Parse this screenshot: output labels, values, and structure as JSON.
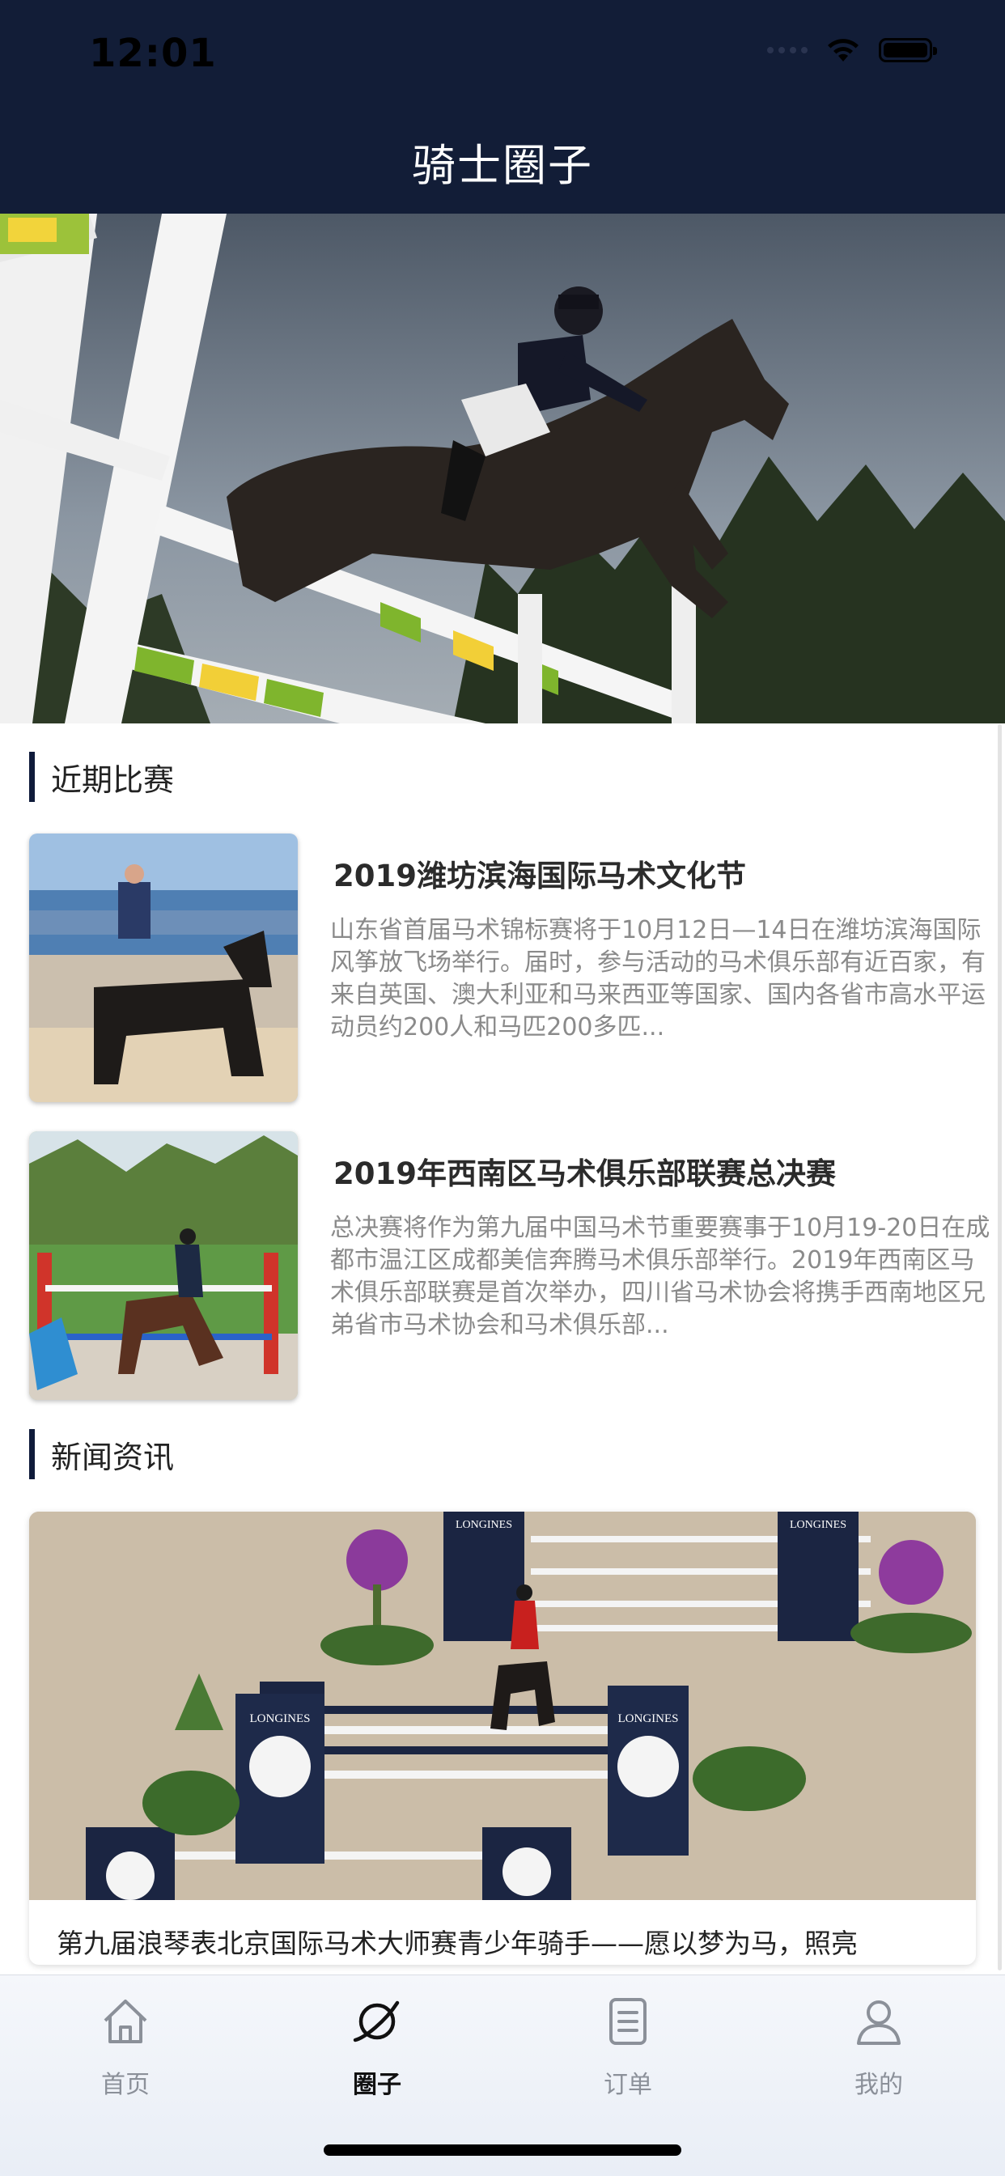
{
  "status_bar": {
    "time": "12:01"
  },
  "header": {
    "title": "骑士圈子"
  },
  "sections": {
    "matches_title": "近期比赛",
    "news_title": "新闻资讯"
  },
  "matches": [
    {
      "title": "2019潍坊滨海国际马术文化节",
      "description": "山东省首届马术锦标赛将于10月12日—14日在潍坊滨海国际风筝放飞场举行。届时，参与活动的马术俱乐部有近百家，有来自英国、澳大利亚和马来西亚等国家、国内各省市高水平运动员约200人和马匹200多匹..."
    },
    {
      "title": "2019年西南区马术俱乐部联赛总决赛",
      "description": "总决赛将作为第九届中国马术节重要赛事于10月19-20日在成都市温江区成都美信奔腾马术俱乐部举行。2019年西南区马术俱乐部联赛是首次举办，四川省马术协会将携手西南地区兄弟省市马术协会和马术俱乐部..."
    }
  ],
  "news": [
    {
      "title": "第九届浪琴表北京国际马术大师赛青少年骑手——愿以梦为马，照亮",
      "brand_text": "LONGINES"
    }
  ],
  "tabbar": {
    "items": [
      {
        "label": "首页",
        "icon": "home-icon",
        "active": false
      },
      {
        "label": "圈子",
        "icon": "planet-icon",
        "active": true
      },
      {
        "label": "订单",
        "icon": "order-list-icon",
        "active": false
      },
      {
        "label": "我的",
        "icon": "user-icon",
        "active": false
      }
    ]
  },
  "colors": {
    "header_bg": "#121d37",
    "accent_bar": "#0f1b3a",
    "active_tab": "#111111",
    "inactive_tab": "#8b9099"
  }
}
